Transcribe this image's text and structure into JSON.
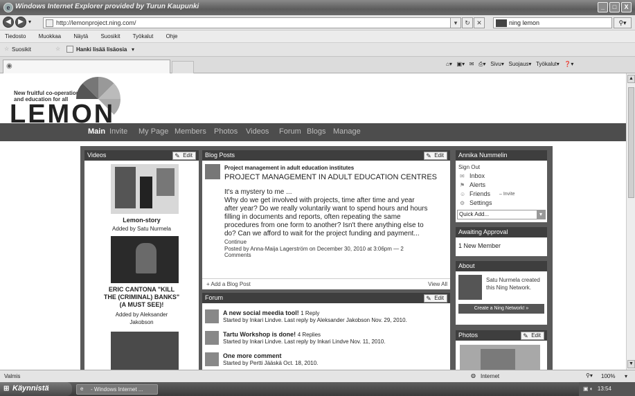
{
  "window": {
    "title": "Windows Internet Explorer provided by Turun Kaupunki",
    "controls": [
      "_",
      "□",
      "X"
    ]
  },
  "address_bar": {
    "url": "http://lemonproject.ning.com/",
    "search_value": "ning lemon"
  },
  "menu": [
    "Tiedosto",
    "Muokkaa",
    "Näytä",
    "Suosikit",
    "Työkalut",
    "Ohje"
  ],
  "favorites_bar": {
    "favorites_label": "Suosikit",
    "more_addons_label": "Hanki lisää lisäosia"
  },
  "command_bar": [
    "Sivu",
    "Suojaus",
    "Työkalut"
  ],
  "site": {
    "tagline_lines": [
      "New fruitful co-operation",
      "and education for all"
    ],
    "logo_text": "LEMON",
    "nav": [
      "Main",
      "Invite",
      "My Page",
      "Members",
      "Photos",
      "Videos",
      "Forum",
      "Blogs",
      "Manage"
    ],
    "active_nav": "Main"
  },
  "videos": {
    "header": "Videos",
    "edit_label": "Edit",
    "items": [
      {
        "title": "Lemon-story",
        "added_by": "Added by Satu Nurmela"
      },
      {
        "title_lines": [
          "ERIC CANTONA \"KILL",
          "THE (CRIMINAL) BANKS\"",
          "(A MUST SEE)!"
        ],
        "added_by_lines": [
          "Added by Aleksander",
          "Jakobson"
        ]
      }
    ]
  },
  "blog": {
    "header": "Blog Posts",
    "edit_label": "Edit",
    "post_title": "Project management in adult education institutes",
    "post_heading": "PROJECT MANAGEMENT IN ADULT EDUCATION CENTRES",
    "body_lines": [
      "It's a mystery to me ...",
      "Why do we get involved with projects, time after time and year",
      "after year? Do we really voluntarily want to spend hours and hours",
      "filling in documents and reports, often repeating the same",
      "procedures from one form to another? Isn't there anything else to",
      "do? Can we afford to wait for the project funding and payment..."
    ],
    "continue_label": "Continue",
    "posted_by_lines": [
      "Posted by Anna-Maija Lagerström on December 30, 2010 at 3:06pm — 2",
      "Comments"
    ],
    "add_label": "+ Add a Blog Post",
    "view_all_label": "View All"
  },
  "forum": {
    "header": "Forum",
    "edit_label": "Edit",
    "threads": [
      {
        "title": "A new social meedia tool!",
        "replies": "1 Reply",
        "meta": "Started by Inkari Lindve. Last reply by Aleksander Jakobson Nov. 29, 2010."
      },
      {
        "title": "Tartu Workshop is done!",
        "replies": "4 Replies",
        "meta": "Started by Inkari Lindve. Last reply by Inkari Lindve Nov. 11, 2010."
      },
      {
        "title": "One more comment",
        "replies": "",
        "meta": "Started by Pertti Jääskä Oct. 18, 2010."
      }
    ]
  },
  "user_panel": {
    "header": "Annika Nummelin",
    "sign_out": "Sign Out",
    "inbox": "Inbox",
    "alerts": "Alerts",
    "friends": "Friends",
    "invite": "– Invite",
    "settings": "Settings",
    "quick_add": "Quick Add..."
  },
  "awaiting": {
    "header": "Awaiting Approval",
    "text": "1 New Member"
  },
  "about": {
    "header": "About",
    "text_lines": [
      "Satu Nurmela created",
      "this Ning Network."
    ],
    "button": "Create a Ning Network! »"
  },
  "photos": {
    "header": "Photos",
    "edit_label": "Edit"
  },
  "status_bar": {
    "left": "Valmis",
    "zone": "Internet",
    "zoom": "100%"
  },
  "taskbar": {
    "start": "Käynnistä",
    "task": "- Windows Internet ...",
    "clock": "13:54"
  }
}
